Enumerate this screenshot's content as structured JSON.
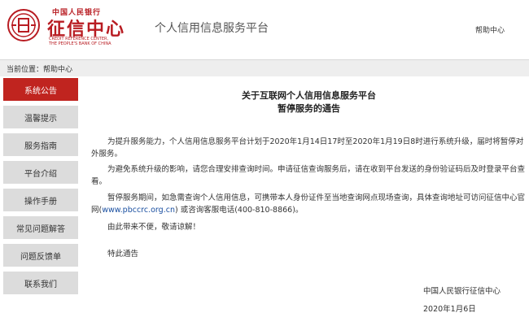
{
  "header": {
    "logo_small": "中国人民银行",
    "logo_big": "征信中心",
    "logo_en_line1": "CREDIT REFERENCE CENTER,",
    "logo_en_line2": "THE PEOPLE'S BANK OF CHINA",
    "site_title": "个人信用信息服务平台",
    "help_link": "帮助中心"
  },
  "breadcrumb": "当前位置：帮助中心",
  "sidebar": {
    "items": [
      {
        "label": "系统公告",
        "active": true
      },
      {
        "label": "温馨提示",
        "active": false
      },
      {
        "label": "服务指南",
        "active": false
      },
      {
        "label": "平台介绍",
        "active": false
      },
      {
        "label": "操作手册",
        "active": false
      },
      {
        "label": "常见问题解答",
        "active": false
      },
      {
        "label": "问题反馈单",
        "active": false
      },
      {
        "label": "联系我们",
        "active": false
      }
    ]
  },
  "notice": {
    "title_line1": "关于互联网个人信用信息服务平台",
    "title_line2": "暂停服务的通告",
    "para1": "为提升服务能力，个人信用信息服务平台计划于2020年1月14日17时至2020年1月19日8时进行系统升级，届时将暂停对外服务。",
    "para2": "为避免系统升级的影响，请您合理安排查询时间。申请征信查询服务后，请在收到平台发送的身份验证码后及时登录平台查看。",
    "para3_before": "暂停服务期间，如急需查询个人信用信息，可携带本人身份证件至当地查询网点现场查询，具体查询地址可访问征信中心官网(",
    "para3_link": "www.pbccrc.org.cn",
    "para3_after": ") 或咨询客服电话(400-810-8866)。",
    "para4": "由此带来不便，敬请谅解！",
    "para5": "特此通告",
    "sign_org": "中国人民银行征信中心",
    "sign_date": "2020年1月6日"
  },
  "colors": {
    "brand_red": "#c0241f",
    "link_blue": "#1a4fa0",
    "sidebar_gray": "#dcdcdc"
  }
}
